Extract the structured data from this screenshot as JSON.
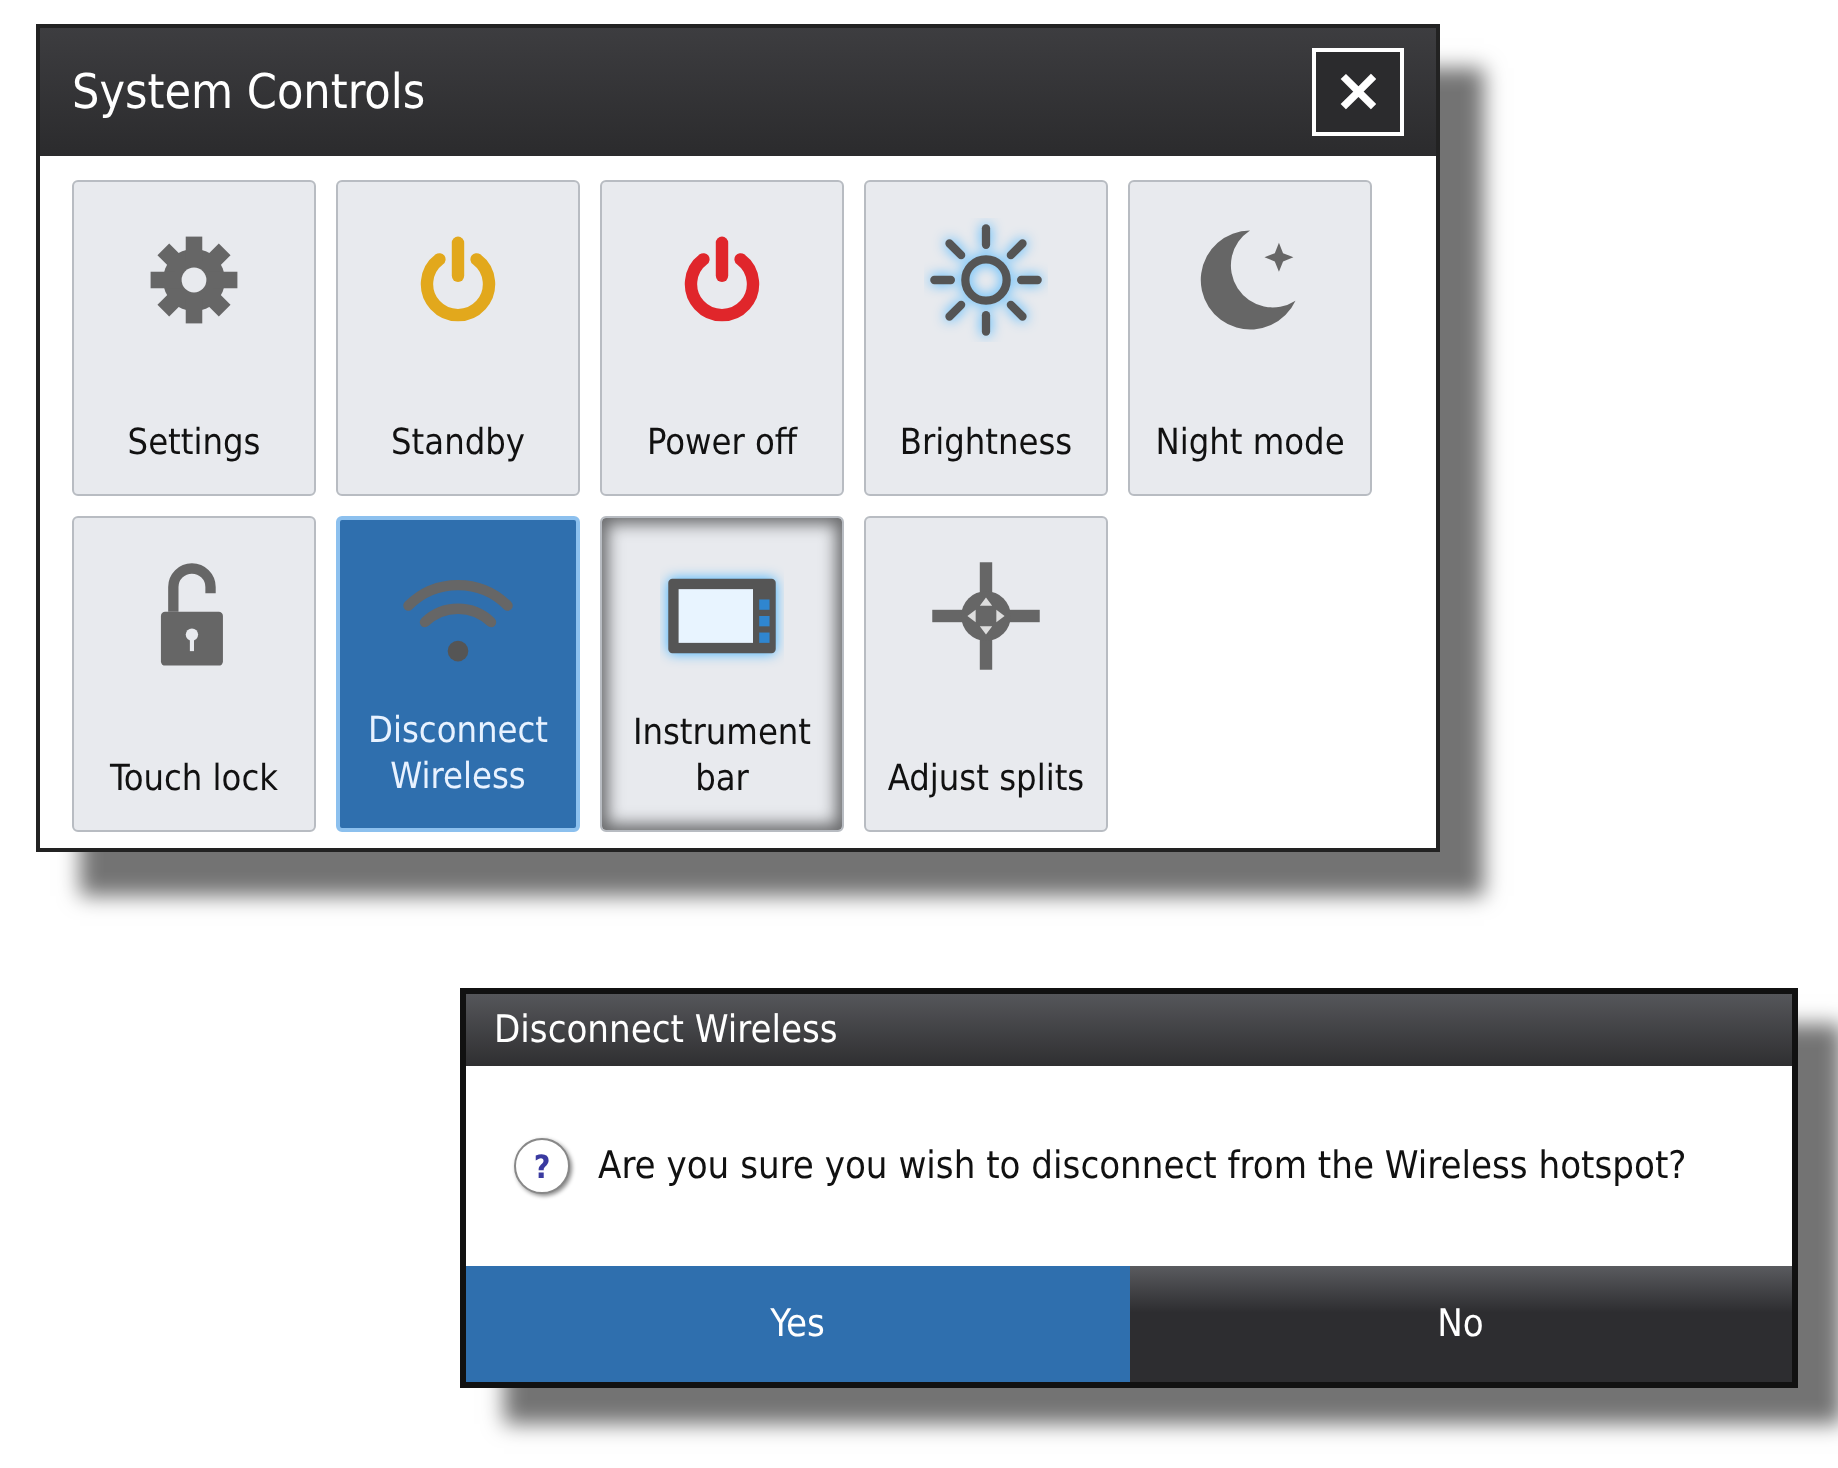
{
  "window": {
    "title": "System Controls",
    "close": "✕"
  },
  "tiles": [
    {
      "label": "Settings",
      "kind": "gear",
      "selected": false,
      "focused": false
    },
    {
      "label": "Standby",
      "kind": "standby",
      "selected": false,
      "focused": false
    },
    {
      "label": "Power off",
      "kind": "poweroff",
      "selected": false,
      "focused": false
    },
    {
      "label": "Brightness",
      "kind": "sun",
      "selected": false,
      "focused": false
    },
    {
      "label": "Night mode",
      "kind": "moon",
      "selected": false,
      "focused": false
    },
    {
      "label": "Touch lock",
      "kind": "lock",
      "selected": false,
      "focused": false
    },
    {
      "label": "Disconnect Wireless",
      "kind": "wifi",
      "selected": true,
      "focused": false
    },
    {
      "label": "Instrument bar",
      "kind": "screen",
      "selected": false,
      "focused": true
    },
    {
      "label": "Adjust splits",
      "kind": "splits",
      "selected": false,
      "focused": false
    }
  ],
  "dialog": {
    "title": "Disconnect Wireless",
    "message": "Are you sure you wish to disconnect from the Wireless hotspot?",
    "icon_text": "?",
    "buttons": [
      {
        "label": "Yes",
        "selected": true
      },
      {
        "label": "No",
        "selected": false
      }
    ]
  }
}
